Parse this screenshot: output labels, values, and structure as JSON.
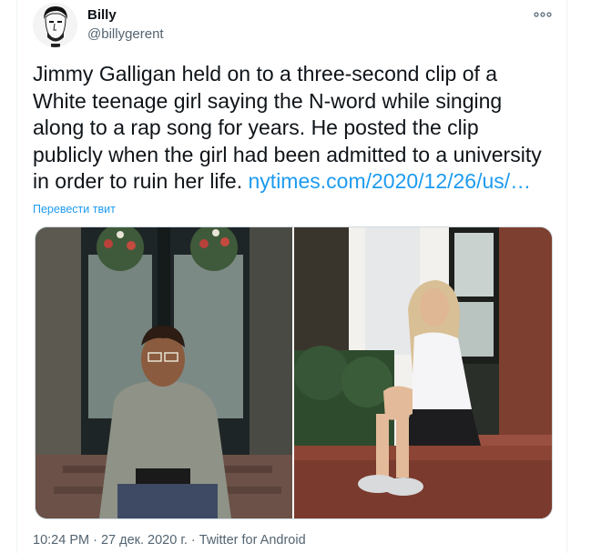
{
  "tweet": {
    "author_name": "Billy",
    "author_handle": "@billygerent",
    "text": "Jimmy Galligan held on to a three-second clip of a White teenage girl saying the N-word while singing along to a rap song for years. He posted the clip publicly when the girl had been admitted to a university in order to ruin her life.",
    "link_text": "nytimes.com/2020/12/26/us/…",
    "translate_label": "Перевести твит",
    "time": "10:24 PM",
    "separator": " · ",
    "date": "27 дек. 2020 г.",
    "source": "Twitter for Android"
  },
  "icons": {
    "more": "more-options-icon",
    "avatar": "avatar-illustration"
  },
  "colors": {
    "link": "#1d9bf0",
    "secondary_text": "#536471",
    "primary_text": "#0f1419"
  }
}
